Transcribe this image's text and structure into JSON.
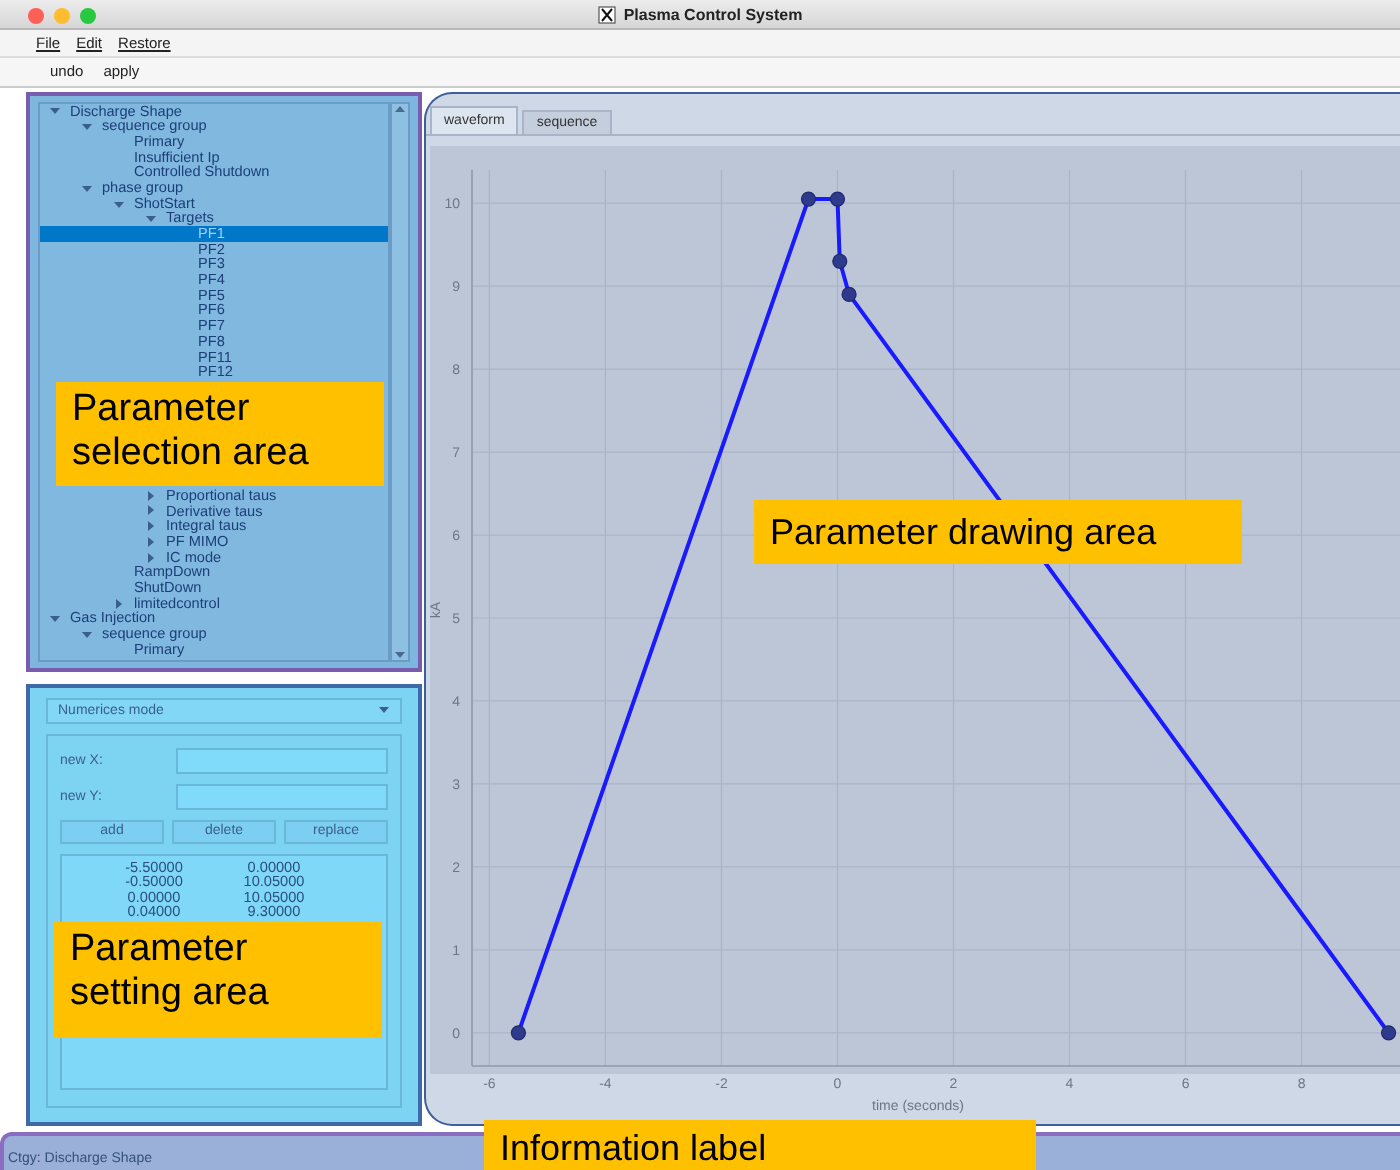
{
  "window": {
    "title": "Plasma Control System"
  },
  "menu": [
    "File",
    "Edit",
    "Restore"
  ],
  "toolbar": [
    "undo",
    "apply"
  ],
  "tree": {
    "items": [
      {
        "label": "Discharge Shape",
        "expanded": true,
        "selected": false,
        "children": [
          {
            "label": "sequence group",
            "expanded": true,
            "selected": false,
            "children": [
              {
                "label": "Primary",
                "selected": false
              },
              {
                "label": "Insufficient Ip",
                "selected": false
              },
              {
                "label": "Controlled Shutdown",
                "selected": false
              }
            ]
          },
          {
            "label": "phase group",
            "expanded": true,
            "selected": false,
            "children": [
              {
                "label": "ShotStart",
                "expanded": true,
                "selected": false,
                "children": [
                  {
                    "label": "Targets",
                    "expanded": true,
                    "selected": false,
                    "partly_hidden": true,
                    "children": [
                      {
                        "label": "PF1",
                        "selected": true
                      },
                      {
                        "label": "PF2",
                        "selected": false
                      },
                      {
                        "label": "PF3",
                        "selected": false
                      },
                      {
                        "label": "PF4",
                        "selected": false
                      },
                      {
                        "label": "PF5",
                        "selected": false
                      },
                      {
                        "label": "PF6",
                        "selected": false
                      },
                      {
                        "label": "PF7",
                        "selected": false
                      },
                      {
                        "label": "PF8",
                        "selected": false
                      },
                      {
                        "label": "PF11",
                        "selected": false
                      },
                      {
                        "label": "PF12",
                        "selected": false
                      }
                    ]
                  },
                  {
                    "label": "Proportional taus",
                    "expanded": false,
                    "selected": false
                  },
                  {
                    "label": "Derivative taus",
                    "expanded": false,
                    "selected": false
                  },
                  {
                    "label": "Integral taus",
                    "expanded": false,
                    "selected": false
                  },
                  {
                    "label": "PF MIMO",
                    "expanded": false,
                    "selected": false
                  },
                  {
                    "label": "IC mode",
                    "expanded": false,
                    "selected": false
                  }
                ]
              },
              {
                "label": "RampDown",
                "selected": false
              },
              {
                "label": "ShutDown",
                "selected": false
              },
              {
                "label": "limitedcontrol",
                "expanded": false,
                "selected": false
              }
            ]
          }
        ]
      },
      {
        "label": "Gas Injection",
        "expanded": true,
        "selected": false,
        "children": [
          {
            "label": "sequence group",
            "expanded": true,
            "selected": false,
            "children": [
              {
                "label": "Primary",
                "selected": false
              }
            ]
          }
        ]
      }
    ],
    "annotation": "Parameter selection area"
  },
  "settings": {
    "mode": "Numerices mode",
    "fields": [
      {
        "label": "new X:"
      },
      {
        "label": "new Y:"
      }
    ],
    "buttons": [
      "add",
      "delete",
      "replace"
    ],
    "points": [
      [
        "-5.50000",
        "0.00000"
      ],
      [
        "-0.50000",
        "10.05000"
      ],
      [
        "0.00000",
        "10.05000"
      ],
      [
        "0.04000",
        "9.30000"
      ]
    ],
    "annotation": "Parameter setting area"
  },
  "chart": {
    "tabs": [
      {
        "label": "waveform",
        "selected": true
      },
      {
        "label": "sequence",
        "selected": false
      }
    ],
    "annotation": "Parameter drawing area",
    "chart_data": {
      "type": "line",
      "xlabel": "time (seconds)",
      "ylabel": "kA",
      "x": [
        -5.5,
        -0.5,
        0,
        0.04,
        0.2,
        9.5
      ],
      "series": [
        {
          "color": "#1a1aff",
          "marker": "circle",
          "values": [
            0,
            10.05,
            10.05,
            9.3,
            8.9,
            0
          ]
        }
      ],
      "xlim": [
        -6.3,
        9.8
      ],
      "ylim": [
        -0.4,
        10.4
      ],
      "grid": true,
      "xticks": [
        -6,
        -4,
        -2,
        0,
        2,
        4,
        6,
        8
      ],
      "yticks": [
        0,
        1,
        2,
        3,
        4,
        5,
        6,
        7,
        8,
        9,
        10
      ]
    }
  },
  "info_bar": {
    "text": "Ctgy: Discharge Shape",
    "annotation": "Information label"
  }
}
